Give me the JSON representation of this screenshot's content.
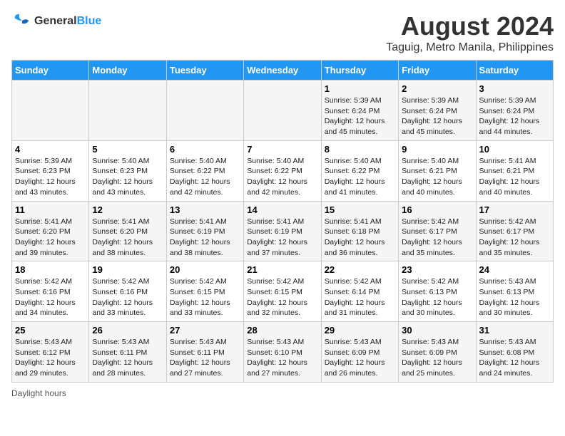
{
  "logo": {
    "line1": "General",
    "line2": "Blue"
  },
  "title": "August 2024",
  "subtitle": "Taguig, Metro Manila, Philippines",
  "days_of_week": [
    "Sunday",
    "Monday",
    "Tuesday",
    "Wednesday",
    "Thursday",
    "Friday",
    "Saturday"
  ],
  "weeks": [
    [
      {
        "day": "",
        "info": ""
      },
      {
        "day": "",
        "info": ""
      },
      {
        "day": "",
        "info": ""
      },
      {
        "day": "",
        "info": ""
      },
      {
        "day": "1",
        "info": "Sunrise: 5:39 AM\nSunset: 6:24 PM\nDaylight: 12 hours\nand 45 minutes."
      },
      {
        "day": "2",
        "info": "Sunrise: 5:39 AM\nSunset: 6:24 PM\nDaylight: 12 hours\nand 45 minutes."
      },
      {
        "day": "3",
        "info": "Sunrise: 5:39 AM\nSunset: 6:24 PM\nDaylight: 12 hours\nand 44 minutes."
      }
    ],
    [
      {
        "day": "4",
        "info": "Sunrise: 5:39 AM\nSunset: 6:23 PM\nDaylight: 12 hours\nand 43 minutes."
      },
      {
        "day": "5",
        "info": "Sunrise: 5:40 AM\nSunset: 6:23 PM\nDaylight: 12 hours\nand 43 minutes."
      },
      {
        "day": "6",
        "info": "Sunrise: 5:40 AM\nSunset: 6:22 PM\nDaylight: 12 hours\nand 42 minutes."
      },
      {
        "day": "7",
        "info": "Sunrise: 5:40 AM\nSunset: 6:22 PM\nDaylight: 12 hours\nand 42 minutes."
      },
      {
        "day": "8",
        "info": "Sunrise: 5:40 AM\nSunset: 6:22 PM\nDaylight: 12 hours\nand 41 minutes."
      },
      {
        "day": "9",
        "info": "Sunrise: 5:40 AM\nSunset: 6:21 PM\nDaylight: 12 hours\nand 40 minutes."
      },
      {
        "day": "10",
        "info": "Sunrise: 5:41 AM\nSunset: 6:21 PM\nDaylight: 12 hours\nand 40 minutes."
      }
    ],
    [
      {
        "day": "11",
        "info": "Sunrise: 5:41 AM\nSunset: 6:20 PM\nDaylight: 12 hours\nand 39 minutes."
      },
      {
        "day": "12",
        "info": "Sunrise: 5:41 AM\nSunset: 6:20 PM\nDaylight: 12 hours\nand 38 minutes."
      },
      {
        "day": "13",
        "info": "Sunrise: 5:41 AM\nSunset: 6:19 PM\nDaylight: 12 hours\nand 38 minutes."
      },
      {
        "day": "14",
        "info": "Sunrise: 5:41 AM\nSunset: 6:19 PM\nDaylight: 12 hours\nand 37 minutes."
      },
      {
        "day": "15",
        "info": "Sunrise: 5:41 AM\nSunset: 6:18 PM\nDaylight: 12 hours\nand 36 minutes."
      },
      {
        "day": "16",
        "info": "Sunrise: 5:42 AM\nSunset: 6:17 PM\nDaylight: 12 hours\nand 35 minutes."
      },
      {
        "day": "17",
        "info": "Sunrise: 5:42 AM\nSunset: 6:17 PM\nDaylight: 12 hours\nand 35 minutes."
      }
    ],
    [
      {
        "day": "18",
        "info": "Sunrise: 5:42 AM\nSunset: 6:16 PM\nDaylight: 12 hours\nand 34 minutes."
      },
      {
        "day": "19",
        "info": "Sunrise: 5:42 AM\nSunset: 6:16 PM\nDaylight: 12 hours\nand 33 minutes."
      },
      {
        "day": "20",
        "info": "Sunrise: 5:42 AM\nSunset: 6:15 PM\nDaylight: 12 hours\nand 33 minutes."
      },
      {
        "day": "21",
        "info": "Sunrise: 5:42 AM\nSunset: 6:15 PM\nDaylight: 12 hours\nand 32 minutes."
      },
      {
        "day": "22",
        "info": "Sunrise: 5:42 AM\nSunset: 6:14 PM\nDaylight: 12 hours\nand 31 minutes."
      },
      {
        "day": "23",
        "info": "Sunrise: 5:42 AM\nSunset: 6:13 PM\nDaylight: 12 hours\nand 30 minutes."
      },
      {
        "day": "24",
        "info": "Sunrise: 5:43 AM\nSunset: 6:13 PM\nDaylight: 12 hours\nand 30 minutes."
      }
    ],
    [
      {
        "day": "25",
        "info": "Sunrise: 5:43 AM\nSunset: 6:12 PM\nDaylight: 12 hours\nand 29 minutes."
      },
      {
        "day": "26",
        "info": "Sunrise: 5:43 AM\nSunset: 6:11 PM\nDaylight: 12 hours\nand 28 minutes."
      },
      {
        "day": "27",
        "info": "Sunrise: 5:43 AM\nSunset: 6:11 PM\nDaylight: 12 hours\nand 27 minutes."
      },
      {
        "day": "28",
        "info": "Sunrise: 5:43 AM\nSunset: 6:10 PM\nDaylight: 12 hours\nand 27 minutes."
      },
      {
        "day": "29",
        "info": "Sunrise: 5:43 AM\nSunset: 6:09 PM\nDaylight: 12 hours\nand 26 minutes."
      },
      {
        "day": "30",
        "info": "Sunrise: 5:43 AM\nSunset: 6:09 PM\nDaylight: 12 hours\nand 25 minutes."
      },
      {
        "day": "31",
        "info": "Sunrise: 5:43 AM\nSunset: 6:08 PM\nDaylight: 12 hours\nand 24 minutes."
      }
    ]
  ],
  "footer": "Daylight hours"
}
